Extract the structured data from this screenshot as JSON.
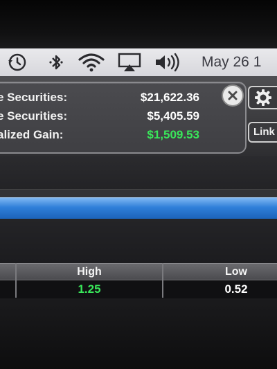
{
  "menubar": {
    "icons": [
      "clock-icon",
      "bluetooth-icon",
      "wifi-icon",
      "airplay-icon",
      "volume-icon"
    ],
    "date": "May 26 1"
  },
  "summary": {
    "rows": [
      {
        "label": "e Securities:",
        "value": "$21,622.36",
        "value_color": "#ffffff"
      },
      {
        "label": "e Securities:",
        "value": "$5,405.59",
        "value_color": "#ffffff"
      },
      {
        "label": "alized Gain:",
        "value": "$1,509.53",
        "value_color": "#39e85a"
      }
    ],
    "link_label": "Link"
  },
  "table": {
    "headers": [
      "High",
      "Low"
    ],
    "rows": [
      {
        "high": "1.25",
        "low": "0.52",
        "high_color": "#39e85a",
        "low_color": "#ffffff"
      }
    ]
  },
  "colors": {
    "accent_blue": "#2f7fd9",
    "gain_green": "#39e85a"
  }
}
